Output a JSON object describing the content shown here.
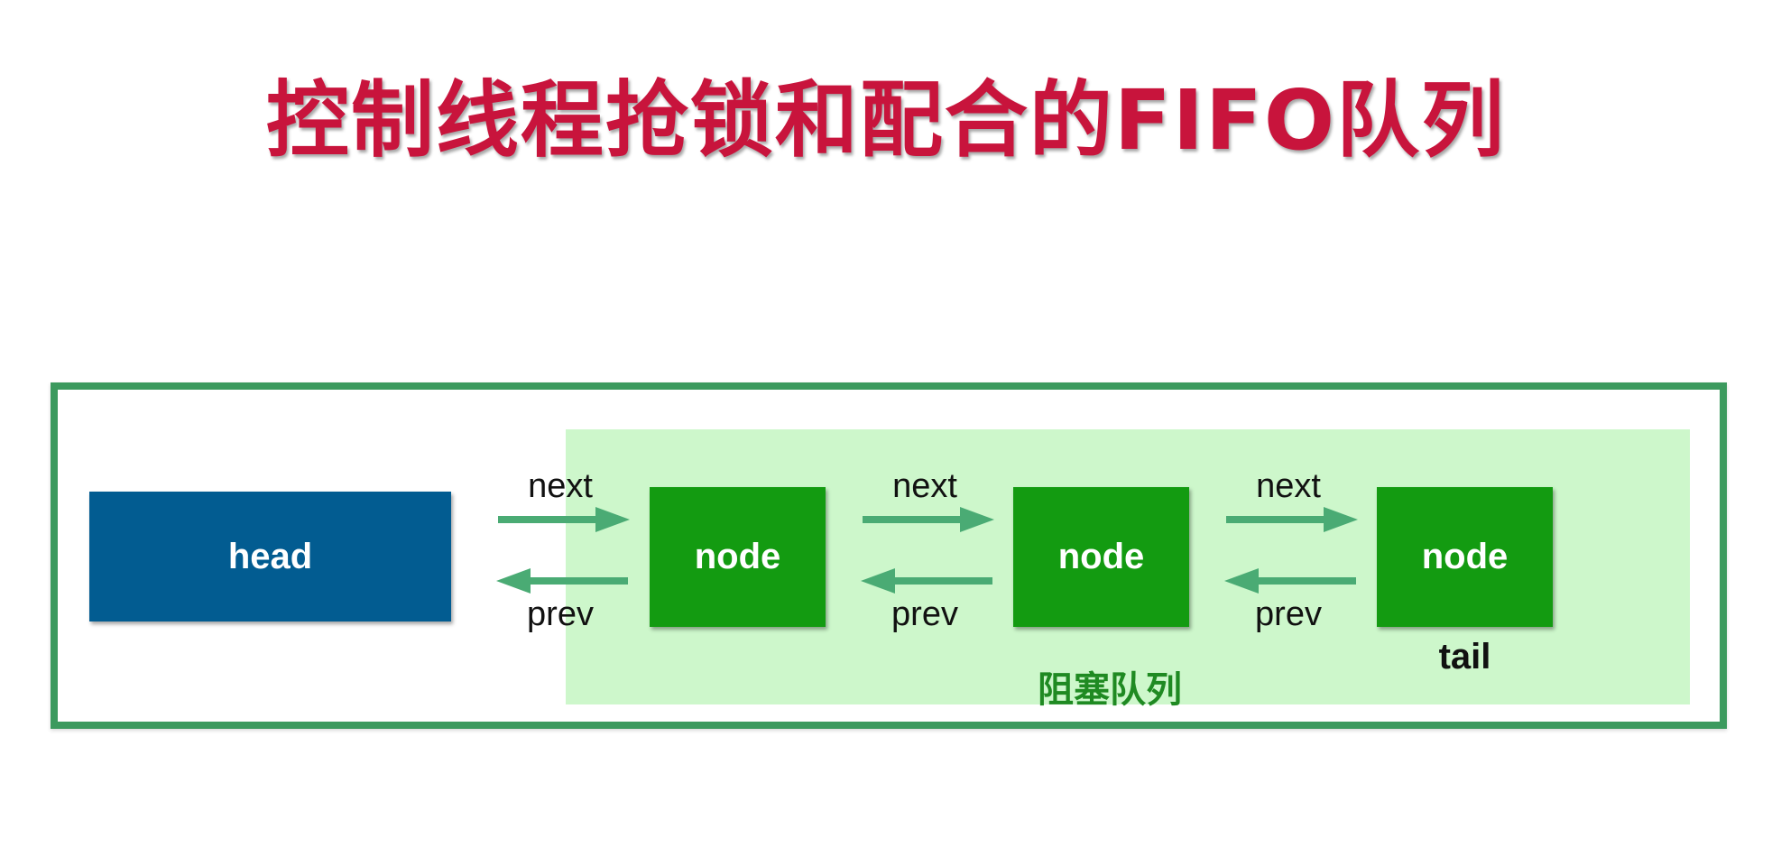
{
  "title": "控制线程抢锁和配合的FIFO队列",
  "diagram": {
    "head_label": "head",
    "nodes": [
      {
        "label": "node"
      },
      {
        "label": "node"
      },
      {
        "label": "node"
      }
    ],
    "links": [
      {
        "next_label": "next",
        "prev_label": "prev"
      },
      {
        "next_label": "next",
        "prev_label": "prev"
      },
      {
        "next_label": "next",
        "prev_label": "prev"
      }
    ],
    "tail_label": "tail",
    "queue_label": "阻塞队列",
    "colors": {
      "title": "#c8143c",
      "head": "#025c91",
      "node": "#139b11",
      "arrow": "#4aab74",
      "frame": "#3c9a5e",
      "queue_region": "#cdf7cb"
    }
  }
}
